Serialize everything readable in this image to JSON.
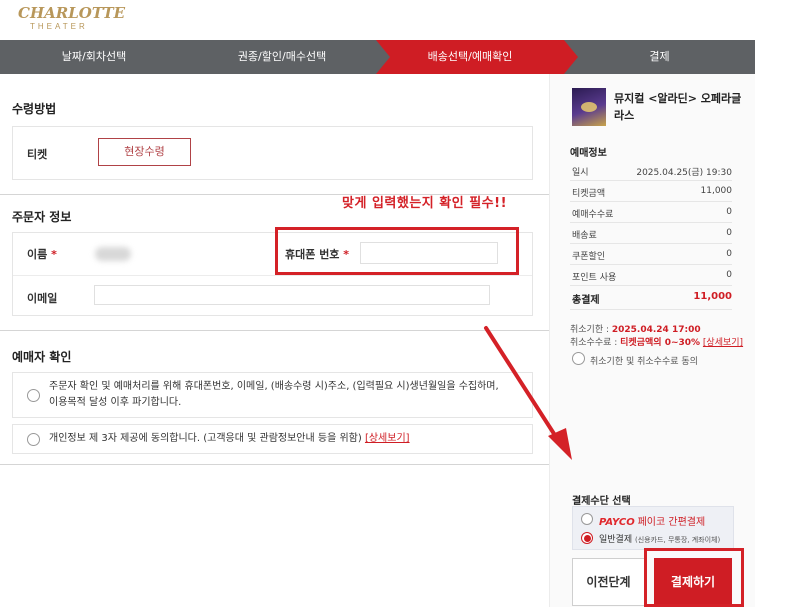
{
  "logo": {
    "main": "CHARLOTTE",
    "sub": "THEATER"
  },
  "steps": [
    {
      "label": "날짜/회차선택",
      "active": false
    },
    {
      "label": "권종/할인/매수선택",
      "active": false
    },
    {
      "label": "배송선택/예매확인",
      "active": true
    },
    {
      "label": "결제",
      "active": false
    }
  ],
  "receive": {
    "title": "수령방법",
    "ticket_label": "티켓",
    "option_label": "현장수령"
  },
  "orderer": {
    "title": "주문자 정보",
    "name_label": "이름",
    "phone_label": "휴대폰 번호",
    "email_label": "이메일",
    "required_mark": "*"
  },
  "annotation": {
    "text": "맞게 입력했는지 확인 필수!!"
  },
  "booker": {
    "title": "예매자 확인",
    "agree1_line1": "주문자 확인 및 예매처리를 위해 휴대폰번호, 이메일, (배송수령 시)주소, (입력필요 시)생년월일을 수집하며,",
    "agree1_line2": "이용목적 달성 이후 파기합니다.",
    "agree2_text": "개인정보 제 3자 제공에 동의합니다. (고객응대 및 관람정보안내 등을 위함)",
    "agree2_link": "[상세보기]"
  },
  "summary": {
    "show_title": "뮤지컬 <알라딘> 오페라글라스",
    "info_head": "예매정보",
    "rows": [
      {
        "key": "일시",
        "value": "2025.04.25(금) 19:30"
      },
      {
        "key": "티켓금액",
        "value": "11,000"
      },
      {
        "key": "예매수수료",
        "value": "0"
      },
      {
        "key": "배송료",
        "value": "0"
      },
      {
        "key": "쿠폰할인",
        "value": "0"
      },
      {
        "key": "포인트 사용",
        "value": "0"
      }
    ],
    "total_key": "총결제",
    "total_value": "11,000",
    "cancel_deadline_label": "취소기한 : ",
    "cancel_deadline_value": "2025.04.24 17:00",
    "cancel_fee_label": "취소수수료 : ",
    "cancel_fee_value": "티켓금액의 0~30%",
    "cancel_fee_link": "[상세보기]",
    "cancel_agree": "취소기한 및 취소수수료 동의"
  },
  "payment": {
    "title": "결제수단 선택",
    "payco_brand": "PAYCO",
    "payco_text": "페이코 간편결제",
    "general_text": "일반결제",
    "general_sub": "(신용카드, 무통장, 계좌이체)",
    "prev_button": "이전단계",
    "pay_button": "결제하기"
  },
  "colors": {
    "accent": "#cf1d24",
    "step_bar": "#5e6164",
    "gold": "#b8975a"
  }
}
